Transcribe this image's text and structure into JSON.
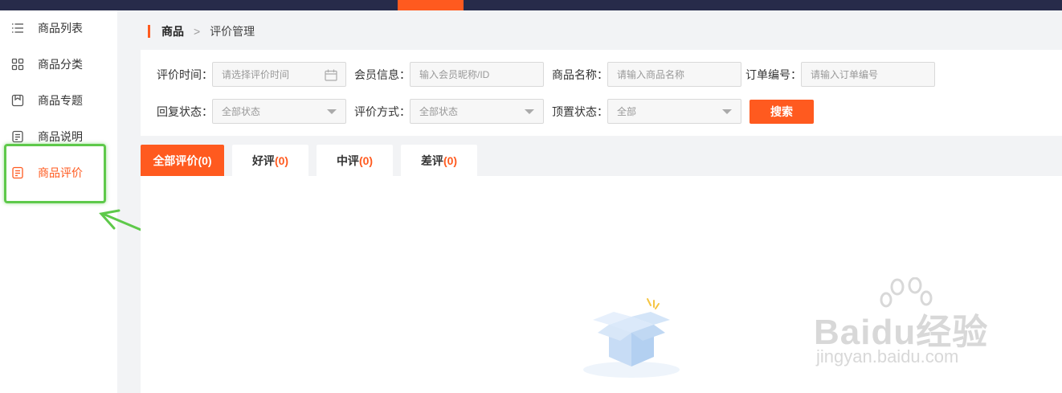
{
  "topbar": {
    "accent_color": "#ff5a1f",
    "bg_color": "#272b4a"
  },
  "sidebar": {
    "items": [
      {
        "label": "商品列表",
        "icon": "list-icon"
      },
      {
        "label": "商品分类",
        "icon": "grid-icon"
      },
      {
        "label": "商品专题",
        "icon": "bookmark-box-icon"
      },
      {
        "label": "商品说明",
        "icon": "document-icon"
      },
      {
        "label": "商品评价",
        "icon": "document-icon",
        "active": true
      }
    ]
  },
  "breadcrumb": {
    "level1": "商品",
    "separator": ">",
    "level2": "评价管理"
  },
  "filters": {
    "review_time": {
      "label": "评价时间：",
      "placeholder": "请选择评价时间"
    },
    "member_info": {
      "label": "会员信息：",
      "placeholder": "输入会员昵称/ID"
    },
    "product_name": {
      "label": "商品名称：",
      "placeholder": "请输入商品名称"
    },
    "order_no": {
      "label": "订单编号：",
      "placeholder": "请输入订单编号"
    },
    "reply_status": {
      "label": "回复状态：",
      "value": "全部状态"
    },
    "review_method": {
      "label": "评价方式：",
      "value": "全部状态"
    },
    "pin_status": {
      "label": "顶置状态：",
      "value": "全部"
    },
    "search_label": "搜索"
  },
  "tabs": [
    {
      "label": "全部评价",
      "count": "(0)",
      "active": true
    },
    {
      "label": "好评",
      "count": "(0)"
    },
    {
      "label": "中评",
      "count": "(0)"
    },
    {
      "label": "差评",
      "count": "(0)"
    }
  ],
  "watermark": {
    "main": "Bai",
    "main2": "du",
    "main3": "经验",
    "sub": "jingyan.baidu.com"
  }
}
